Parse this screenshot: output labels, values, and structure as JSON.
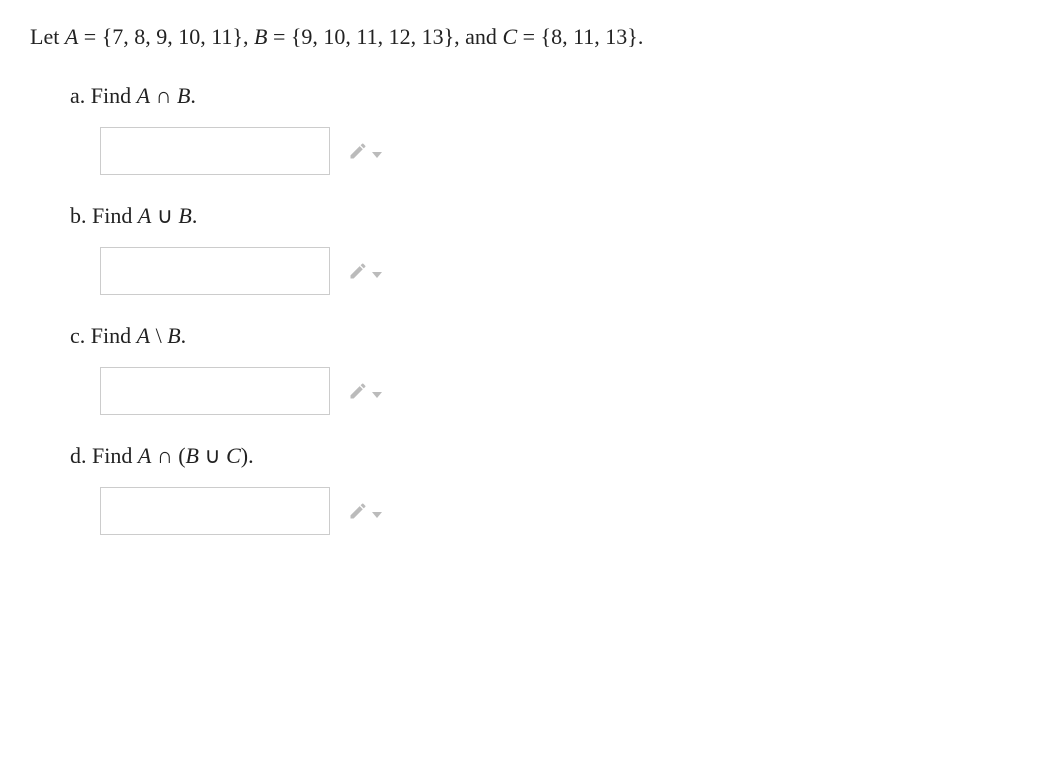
{
  "intro": {
    "let": "Let ",
    "A_eq": " = {7, 8, 9, 10, 11}, ",
    "B_eq": " = {9, 10, 11, 12, 13}, ",
    "and": "and ",
    "C_eq": " = {8, 11, 13}."
  },
  "questions": [
    {
      "letter": "a.",
      "prefix": "Find ",
      "expr_html": "<span class='mi'>A</span> ∩ <span class='mi'>B</span>."
    },
    {
      "letter": "b.",
      "prefix": "Find ",
      "expr_html": "<span class='mi'>A</span> ∪ <span class='mi'>B</span>."
    },
    {
      "letter": "c.",
      "prefix": "Find ",
      "expr_html": "<span class='mi'>A</span> \\ <span class='mi'>B</span>."
    },
    {
      "letter": "d.",
      "prefix": "Find ",
      "expr_html": "<span class='mi'>A</span> ∩ (<span class='mi'>B</span> ∪ <span class='mi'>C</span>)."
    }
  ],
  "sets": {
    "A": [
      7,
      8,
      9,
      10,
      11
    ],
    "B": [
      9,
      10,
      11,
      12,
      13
    ],
    "C": [
      8,
      11,
      13
    ]
  }
}
